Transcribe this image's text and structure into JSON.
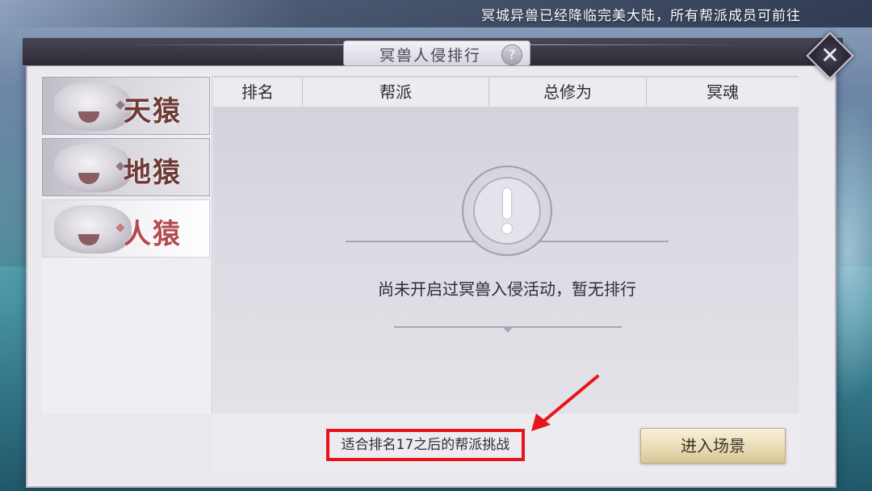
{
  "marquee": {
    "text": "冥城异兽已经降临完美大陆，所有帮派成员可前往"
  },
  "dialog": {
    "title": "冥兽人侵排行",
    "help_label": "?",
    "close_label": "✕"
  },
  "beasts": [
    {
      "name": "天猿",
      "active": false
    },
    {
      "name": "地猿",
      "active": false
    },
    {
      "name": "人猿",
      "active": true
    }
  ],
  "table": {
    "columns": [
      "排名",
      "帮派",
      "总修为",
      "冥魂"
    ]
  },
  "empty_state": {
    "message": "尚未开启过冥兽入侵活动，暂无排行",
    "icon": "exclamation-icon"
  },
  "footer": {
    "hint": "适合排名17之后的帮派挑战",
    "enter_button": "进入场景"
  },
  "colors": {
    "annotation_red": "#e8141c",
    "button_gold": "#e8dab3"
  }
}
